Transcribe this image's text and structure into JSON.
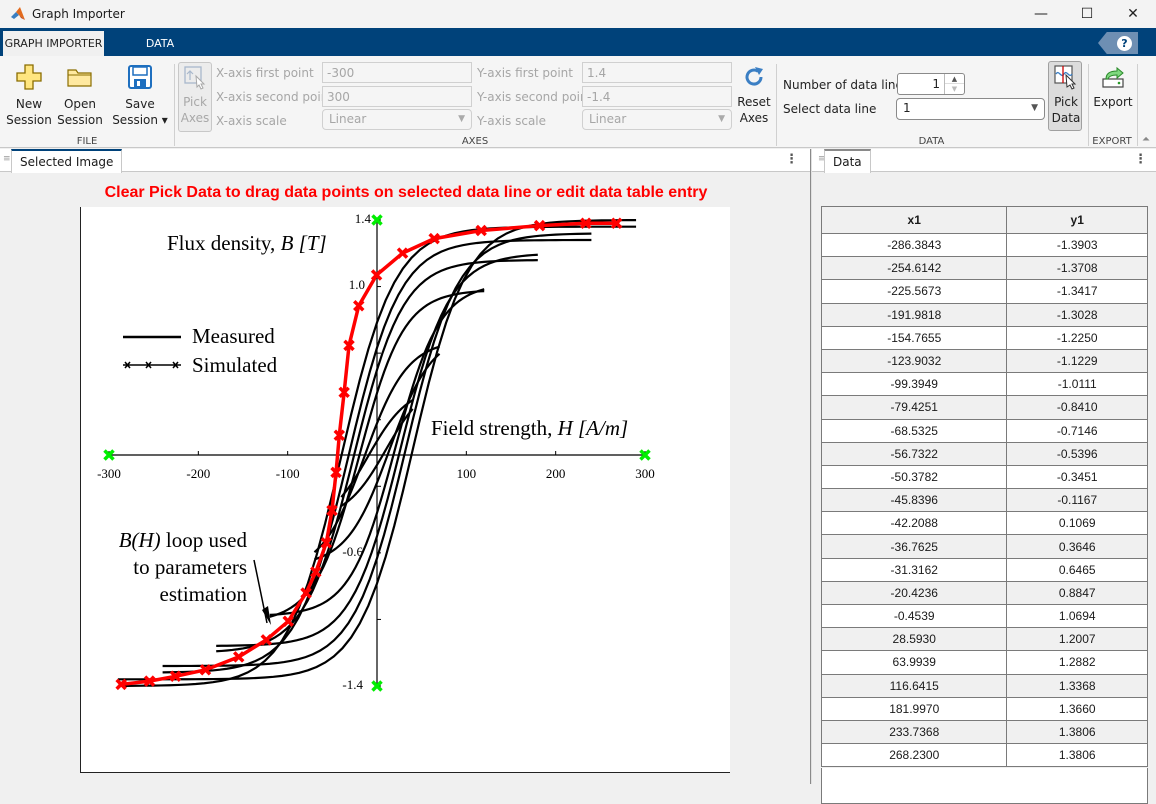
{
  "window": {
    "title": "Graph Importer",
    "controls": {
      "minimize": "—",
      "maximize": "☐",
      "close": "✕"
    }
  },
  "ribbon_tabs": [
    {
      "label": "GRAPH IMPORTER",
      "active": true
    },
    {
      "label": "DATA",
      "active": false
    }
  ],
  "help_icon": "?",
  "file_section": {
    "label": "FILE",
    "new_session": {
      "line1": "New",
      "line2": "Session"
    },
    "open_session": {
      "line1": "Open",
      "line2": "Session"
    },
    "save_session": {
      "line1": "Save",
      "line2": "Session ▾"
    }
  },
  "axes_section": {
    "label": "AXES",
    "pick_axes": {
      "line1": "Pick",
      "line2": "Axes"
    },
    "x_first_label": "X-axis first point",
    "x_first_value": "-300",
    "x_second_label": "X-axis second point",
    "x_second_value": "300",
    "x_scale_label": "X-axis scale",
    "x_scale_value": "Linear",
    "y_first_label": "Y-axis first point",
    "y_first_value": "1.4",
    "y_second_label": "Y-axis second point",
    "y_second_value": "-1.4",
    "y_scale_label": "Y-axis scale",
    "y_scale_value": "Linear",
    "reset_axes": {
      "line1": "Reset",
      "line2": "Axes"
    }
  },
  "data_section": {
    "label": "DATA",
    "num_lines_label": "Number of data lines",
    "num_lines_value": "1",
    "select_line_label": "Select data line",
    "select_line_value": "1",
    "pick_data": {
      "line1": "Pick",
      "line2": "Data"
    }
  },
  "export_section": {
    "label": "EXPORT",
    "export": "Export"
  },
  "left_panel": {
    "tab": "Selected Image",
    "instruction": "Clear Pick Data to drag data points on selected data line or edit data table entry"
  },
  "image": {
    "y_title_prefix": "Flux density, ",
    "y_title_var": "B [T]",
    "x_title_prefix": "Field strength, ",
    "x_title_var": "H [A/m]",
    "legend": [
      {
        "label": "Measured",
        "style": "solid"
      },
      {
        "label": "Simulated",
        "style": "crossed"
      }
    ],
    "annotation": {
      "line1_var": "B(H)",
      "line1_rest": " loop used",
      "line2": "to parameters",
      "line3": "estimation"
    },
    "x_ticks": [
      "-300",
      "-200",
      "-100",
      "100",
      "200",
      "300"
    ],
    "y_ticks": [
      "1.4",
      "1.0",
      "-0.6",
      "-1.4"
    ],
    "trace_color": "#ff0000",
    "calibration_color": "#00ee00"
  },
  "right_panel": {
    "tab": "Data",
    "columns": [
      "x1",
      "y1"
    ]
  },
  "chart_data": {
    "type": "line",
    "title": "",
    "xlabel": "Field strength, H [A/m]",
    "ylabel": "Flux density, B [T]",
    "xlim": [
      -300,
      300
    ],
    "ylim": [
      -1.4,
      1.4
    ],
    "axis_calibration": {
      "x": [
        -300,
        300
      ],
      "y": [
        1.4,
        -1.4
      ]
    },
    "series": [
      {
        "name": "data line 1",
        "x": [
          -286.3843,
          -254.6142,
          -225.5673,
          -191.9818,
          -154.7655,
          -123.9032,
          -99.3949,
          -79.4251,
          -68.5325,
          -56.7322,
          -50.3782,
          -45.8396,
          -42.2088,
          -36.7625,
          -31.3162,
          -20.4236,
          -0.4539,
          28.593,
          63.9939,
          116.6415,
          181.997,
          233.7368,
          268.23
        ],
        "y": [
          -1.3903,
          -1.3708,
          -1.3417,
          -1.3028,
          -1.225,
          -1.1229,
          -1.0111,
          -0.841,
          -0.7146,
          -0.5396,
          -0.3451,
          -0.1167,
          0.1069,
          0.3646,
          0.6465,
          0.8847,
          1.0694,
          1.2007,
          1.2882,
          1.3368,
          1.366,
          1.3806,
          1.3806
        ]
      }
    ]
  },
  "table_rows": [
    [
      "-286.3843",
      "-1.3903"
    ],
    [
      "-254.6142",
      "-1.3708"
    ],
    [
      "-225.5673",
      "-1.3417"
    ],
    [
      "-191.9818",
      "-1.3028"
    ],
    [
      "-154.7655",
      "-1.2250"
    ],
    [
      "-123.9032",
      "-1.1229"
    ],
    [
      "-99.3949",
      "-1.0111"
    ],
    [
      "-79.4251",
      "-0.8410"
    ],
    [
      "-68.5325",
      "-0.7146"
    ],
    [
      "-56.7322",
      "-0.5396"
    ],
    [
      "-50.3782",
      "-0.3451"
    ],
    [
      "-45.8396",
      "-0.1167"
    ],
    [
      "-42.2088",
      "0.1069"
    ],
    [
      "-36.7625",
      "0.3646"
    ],
    [
      "-31.3162",
      "0.6465"
    ],
    [
      "-20.4236",
      "0.8847"
    ],
    [
      "-0.4539",
      "1.0694"
    ],
    [
      "28.5930",
      "1.2007"
    ],
    [
      "63.9939",
      "1.2882"
    ],
    [
      "116.6415",
      "1.3368"
    ],
    [
      "181.9970",
      "1.3660"
    ],
    [
      "233.7368",
      "1.3806"
    ],
    [
      "268.2300",
      "1.3806"
    ]
  ]
}
